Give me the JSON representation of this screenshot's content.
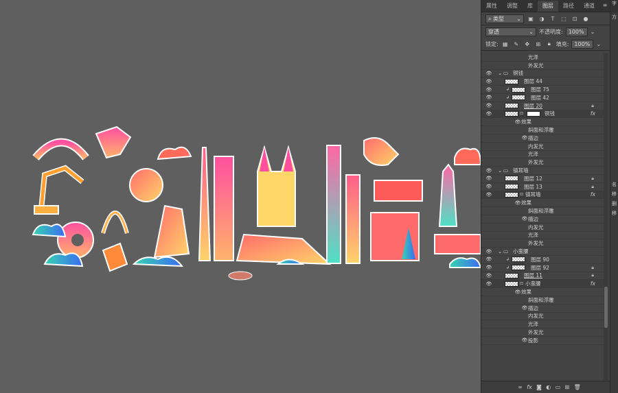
{
  "tabs": [
    "属性",
    "调整",
    "库",
    "图层",
    "路径",
    "通道"
  ],
  "active_tab": "图层",
  "filter": {
    "kind_label": "类型"
  },
  "blend": {
    "mode": "穿透",
    "opacity_label": "不透明度:",
    "opacity_value": "100%"
  },
  "lock": {
    "label": "锁定:",
    "fill_label": "填充:",
    "fill_value": "100%"
  },
  "layers": [
    {
      "type": "effect",
      "name": "光泽",
      "indent": 68,
      "eye": false
    },
    {
      "type": "effect",
      "name": "外发光",
      "indent": 68,
      "eye": false
    },
    {
      "type": "group",
      "name": "铜钱",
      "eye": true
    },
    {
      "type": "layer",
      "name": "图层 44",
      "eye": true,
      "clip": false,
      "lock": false
    },
    {
      "type": "layer",
      "name": "图层 75",
      "eye": true,
      "clip": true,
      "lock": false
    },
    {
      "type": "layer",
      "name": "图层 42",
      "eye": true,
      "clip": true,
      "lock": false
    },
    {
      "type": "layer",
      "name": "图层 20",
      "eye": true,
      "clip": false,
      "lock": true,
      "underline": true
    },
    {
      "type": "smart",
      "name": "铜钱",
      "eye": true,
      "fx": true,
      "mask": true
    },
    {
      "type": "effect",
      "name": "效果",
      "indent": 58,
      "eye": true
    },
    {
      "type": "effect",
      "name": "斜面和浮雕",
      "indent": 68,
      "eye": false
    },
    {
      "type": "effect",
      "name": "描边",
      "indent": 68,
      "eye": true
    },
    {
      "type": "effect",
      "name": "内发光",
      "indent": 68,
      "eye": false
    },
    {
      "type": "effect",
      "name": "光泽",
      "indent": 68,
      "eye": false
    },
    {
      "type": "effect",
      "name": "外发光",
      "indent": 68,
      "eye": false
    },
    {
      "type": "group",
      "name": "镇耳墙",
      "eye": true
    },
    {
      "type": "layer",
      "name": "图层 12",
      "eye": true,
      "clip": false,
      "lock": true
    },
    {
      "type": "layer",
      "name": "图层 13",
      "eye": true,
      "clip": false,
      "lock": true
    },
    {
      "type": "smart",
      "name": "镇耳墙",
      "eye": true,
      "fx": true,
      "mask": false
    },
    {
      "type": "effect",
      "name": "效果",
      "indent": 58,
      "eye": true
    },
    {
      "type": "effect",
      "name": "斜面和浮雕",
      "indent": 68,
      "eye": false
    },
    {
      "type": "effect",
      "name": "描边",
      "indent": 68,
      "eye": true
    },
    {
      "type": "effect",
      "name": "内发光",
      "indent": 68,
      "eye": false
    },
    {
      "type": "effect",
      "name": "光泽",
      "indent": 68,
      "eye": false
    },
    {
      "type": "effect",
      "name": "外发光",
      "indent": 68,
      "eye": false
    },
    {
      "type": "group",
      "name": "小蛮腰",
      "eye": true
    },
    {
      "type": "layer",
      "name": "图层 90",
      "eye": true,
      "clip": true,
      "lock": false
    },
    {
      "type": "layer",
      "name": "图层 92",
      "eye": true,
      "clip": true,
      "lock": true
    },
    {
      "type": "layer",
      "name": "图层 11",
      "eye": true,
      "clip": false,
      "lock": true,
      "underline": true
    },
    {
      "type": "smart",
      "name": "小蛮腰",
      "eye": true,
      "fx": true,
      "mask": false
    },
    {
      "type": "effect",
      "name": "效果",
      "indent": 58,
      "eye": true
    },
    {
      "type": "effect",
      "name": "斜面和浮雕",
      "indent": 68,
      "eye": false
    },
    {
      "type": "effect",
      "name": "描边",
      "indent": 68,
      "eye": true
    },
    {
      "type": "effect",
      "name": "内发光",
      "indent": 68,
      "eye": false
    },
    {
      "type": "effect",
      "name": "光泽",
      "indent": 68,
      "eye": false
    },
    {
      "type": "effect",
      "name": "外发光",
      "indent": 68,
      "eye": false
    },
    {
      "type": "effect",
      "name": "投影",
      "indent": 68,
      "eye": true
    }
  ],
  "right_strip": [
    "字",
    "方",
    "名",
    "移",
    "删",
    "移"
  ],
  "bottom_icons": [
    "link-icon",
    "fx-icon",
    "mask-icon",
    "adjust-icon",
    "folder-icon",
    "new-layer-icon",
    "trash-icon"
  ],
  "bottom_labels": {
    "link": "∞",
    "fx": "fx"
  }
}
